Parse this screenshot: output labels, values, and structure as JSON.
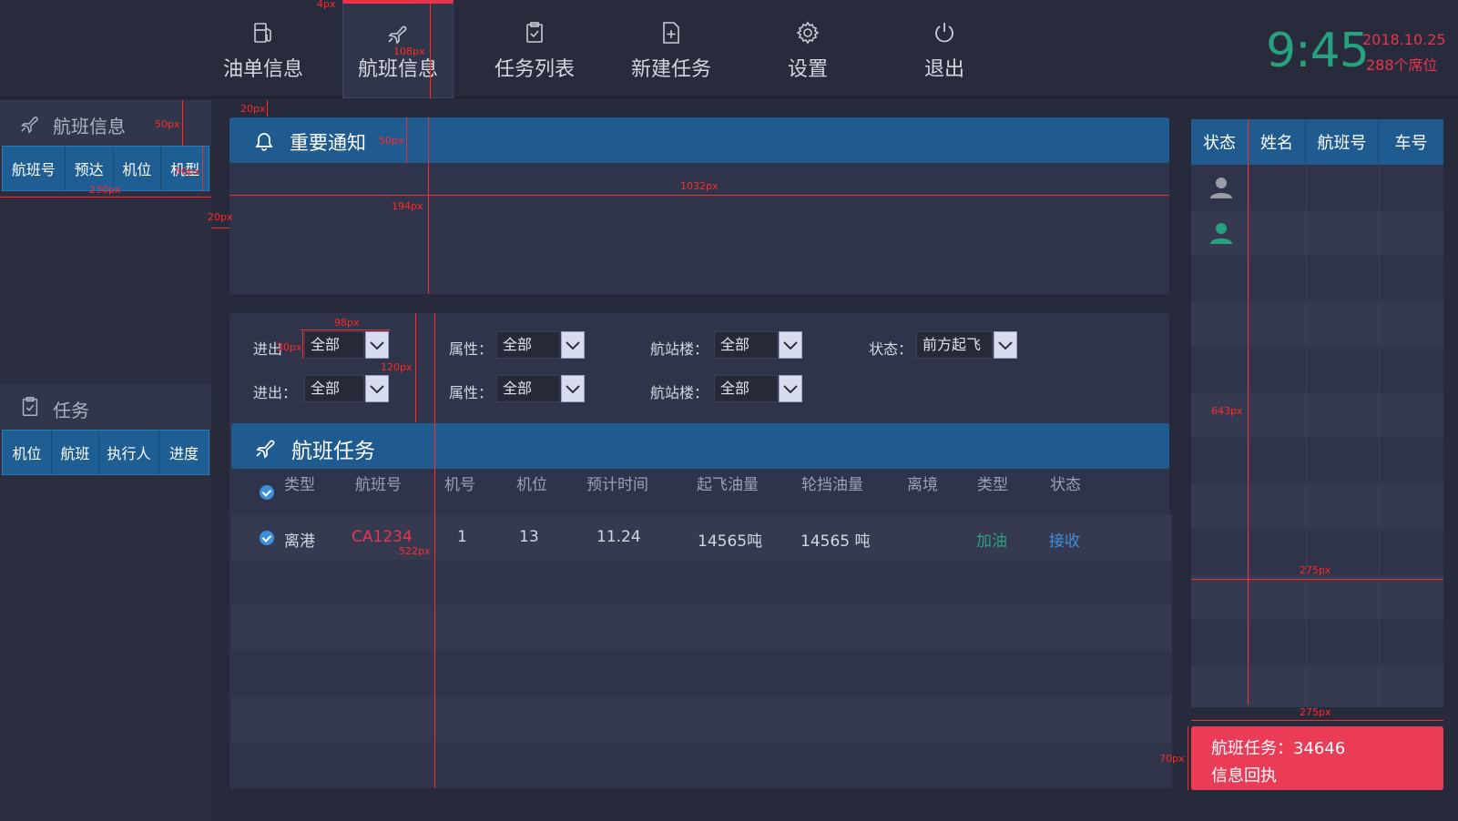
{
  "nav": {
    "items": [
      {
        "label": "油单信息",
        "icon": "fuel-pump-icon"
      },
      {
        "label": "航班信息",
        "icon": "airplane-icon",
        "active": true
      },
      {
        "label": "任务列表",
        "icon": "clipboard-check-icon"
      },
      {
        "label": "新建任务",
        "icon": "file-plus-icon"
      },
      {
        "label": "设置",
        "icon": "gear-icon"
      },
      {
        "label": "退出",
        "icon": "power-icon"
      }
    ]
  },
  "header": {
    "time": "9:45",
    "date": "2018.10.25",
    "seats": "288个席位"
  },
  "sidebar": {
    "flight": {
      "title": "航班信息",
      "tabs": [
        "航班号",
        "预达",
        "机位",
        "机型"
      ]
    },
    "task": {
      "title": "任务",
      "tabs": [
        "机位",
        "航班",
        "执行人",
        "进度"
      ]
    }
  },
  "notice": {
    "title": "重要通知"
  },
  "filters": {
    "row1": [
      {
        "label": "进出",
        "value": "全部"
      },
      {
        "label": "属性：",
        "value": "全部"
      },
      {
        "label": "航站楼：",
        "value": "全部"
      },
      {
        "label": "状态：",
        "value": "前方起飞"
      }
    ],
    "row2": [
      {
        "label": "进出：",
        "value": "全部"
      },
      {
        "label": "属性：",
        "value": "全部"
      },
      {
        "label": "航站楼：",
        "value": "全部"
      }
    ]
  },
  "tasks": {
    "title": "航班任务",
    "columns": [
      "类型",
      "航班号",
      "机号",
      "机位",
      "预计时间",
      "起飞油量",
      "轮挡油量",
      "离境",
      "类型",
      "状态"
    ],
    "rows": [
      {
        "type": "离港",
        "flight": "CA1234",
        "tail": "1",
        "stand": "13",
        "eta": "11.24",
        "takeoff_fuel": "14565吨",
        "block_fuel": "14565 吨",
        "departure": "",
        "kind": "加油",
        "status": "接收"
      }
    ]
  },
  "staff": {
    "columns": [
      "状态",
      "姓名",
      "航班号",
      "车号"
    ],
    "rows": [
      {
        "status_icon": "user-icon",
        "status_color": "#9a9ca6"
      },
      {
        "status_icon": "user-icon",
        "status_color": "#27a17f"
      }
    ]
  },
  "receipt": {
    "line1": "航班任务：34646",
    "line2": "信息回执"
  },
  "annotations": {
    "a1": "4px",
    "a2": "108px",
    "a3": "20px",
    "a4": "50px",
    "a5": "50px",
    "a6": "50px",
    "a7": "230px",
    "a8": "20px",
    "a9": "1032px",
    "a10": "194px",
    "a11": "98px",
    "a12": "30px",
    "a13": "120px",
    "a14": "522px",
    "a15": "643px",
    "a16": "275px",
    "a17": "275px",
    "a18": "70px"
  },
  "colors": {
    "accent_red": "#e8344f",
    "accent_green": "#27a17f",
    "bar_blue": "#1f5b8f",
    "link_blue": "#3d8fd9"
  }
}
